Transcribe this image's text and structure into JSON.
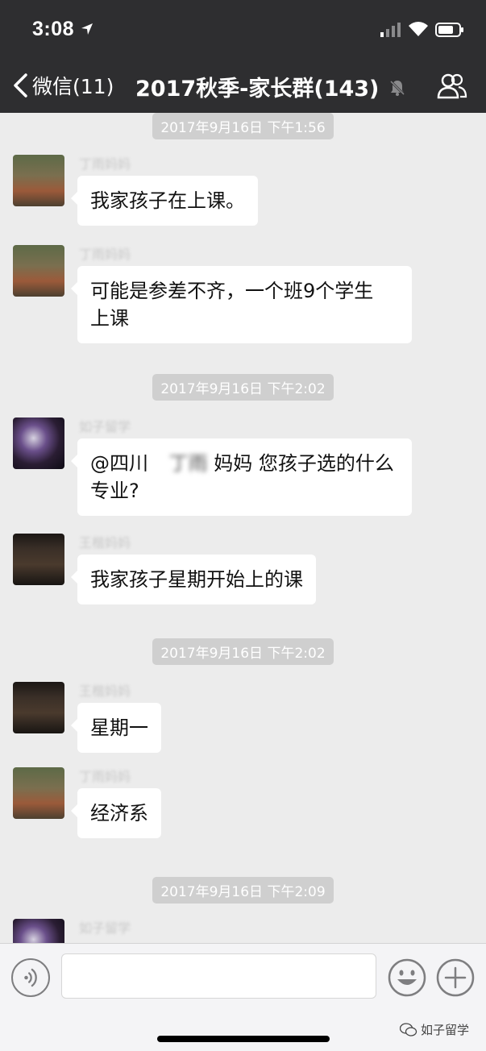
{
  "status_bar": {
    "time": "3:08"
  },
  "nav": {
    "back_label": "微信(11)",
    "title": "2017秋季-家长群(143)"
  },
  "timestamps": [
    "2017年9月16日 下午1:56",
    "2017年9月16日 下午2:02",
    "2017年9月16日 下午2:02",
    "2017年9月16日 下午2:09"
  ],
  "messages": [
    {
      "sender": "丁雨妈妈",
      "text": "我家孩子在上课。"
    },
    {
      "sender": "丁雨妈妈",
      "line1": "可能是参差不齐，一个班9个学生",
      "line2": "上课"
    },
    {
      "sender": "如子留学",
      "prefix": "@四川",
      "hidden": "丁雨",
      "suffix": "妈妈 您孩子选的什么",
      "line2": "专业?"
    },
    {
      "sender": "王楷妈妈",
      "text": "我家孩子星期开始上的课"
    },
    {
      "sender": "王楷妈妈",
      "text": "星期一"
    },
    {
      "sender": "丁雨妈妈",
      "text": "经济系"
    },
    {
      "sender": "如子留学"
    }
  ],
  "input": {
    "value": "",
    "placeholder": ""
  },
  "watermark": "如子留学",
  "colors": {
    "header_bg": "#2e2e30",
    "chat_bg": "#ececec",
    "bubble": "#ffffff",
    "timestamp_bg": "#cfcfcf"
  }
}
